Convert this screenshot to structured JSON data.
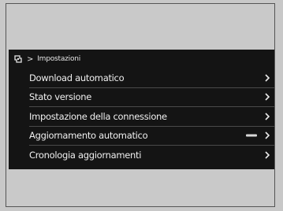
{
  "breadcrumb": {
    "separator": ">",
    "title": "Impostazioni",
    "icon": "settings-car-icon"
  },
  "menu": {
    "items": [
      {
        "label": "Download automatico",
        "icon": "chevron-right-icon"
      },
      {
        "label": "Stato versione",
        "icon": "chevron-right-icon"
      },
      {
        "label": "Impostazione della connessione",
        "icon": "chevron-right-icon"
      },
      {
        "label": "Aggiornamento automatico",
        "icon": "chevron-right-icon",
        "toggle_icon": "toggle-off-indicator"
      },
      {
        "label": "Cronologia aggiornamenti",
        "icon": "chevron-right-icon"
      }
    ]
  },
  "colors": {
    "screen_background": "#141414",
    "text": "#f0f0f0",
    "divider": "#4a4a4a",
    "page_background": "#c8c8c8"
  }
}
